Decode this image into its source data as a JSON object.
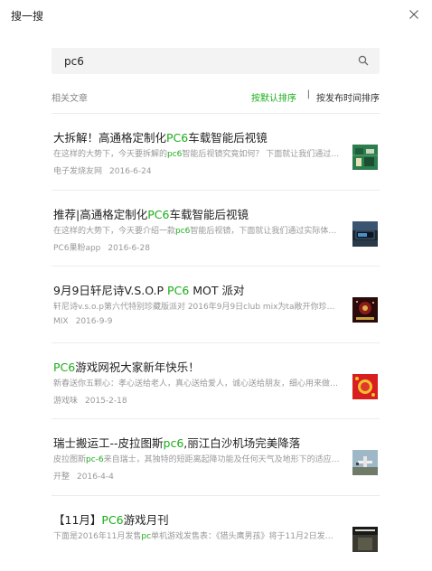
{
  "app": {
    "title": "搜一搜"
  },
  "search": {
    "value": "pc6",
    "placeholder": ""
  },
  "filter": {
    "label": "相关文章",
    "sort_default": "按默认排序",
    "separator": "|",
    "sort_time": "按发布时间排序",
    "active": "sort_default"
  },
  "accent_color": "#1aad19",
  "results": [
    {
      "title_pre": "大拆解！高通格定制化",
      "title_hl": "PC6",
      "title_post": "车载智能后视镜",
      "snippet_pre": "在这样的大势下，今天要拆解的",
      "snippet_hl": "pc6",
      "snippet_post": "智能后视镜究竟如何？ 下面就让我们通过拆解…",
      "source": "电子发烧友网",
      "date": "2016-6-24",
      "thumb": "circuit-board-image"
    },
    {
      "title_pre": "推荐|高通格定制化",
      "title_hl": "PC6",
      "title_post": "车载智能后视镜",
      "snippet_pre": "在这样的大势下，今天要介绍一款",
      "snippet_hl": "pc6",
      "snippet_post": "智能后视镜，下面就让我们通过实际体验…",
      "source": "PC6果粉app",
      "date": "2016-6-28",
      "thumb": "car-dashboard-image"
    },
    {
      "title_pre": "9月9日轩尼诗V.S.O.P ",
      "title_hl": "PC6",
      "title_post": " MOT 派对",
      "snippet_pre": "轩尼诗v.s.o.p第六代特别珍藏版派对 2016年9月9日club mix为ta敞开你珍藏的…",
      "snippet_hl": "",
      "snippet_post": "",
      "source": "MIX",
      "date": "2016-9-9",
      "thumb": "party-poster-image"
    },
    {
      "title_pre": "",
      "title_hl": "PC6",
      "title_post": "游戏网祝大家新年快乐！",
      "snippet_pre": "新春送你五颗心：孝心送给老人，真心送给爱人，诚心送给朋友，细心用来做事…",
      "snippet_hl": "",
      "snippet_post": "",
      "source": "游戏味",
      "date": "2015-2-18",
      "thumb": "new-year-red-image"
    },
    {
      "title_pre": "瑞士搬运工--皮拉图斯",
      "title_hl": "pc6",
      "title_post": ",丽江白沙机场完美降落",
      "snippet_pre": "皮拉图斯",
      "snippet_hl": "pc-6",
      "snippet_post": "来自瑞士，其独特的短距离起降功能及任何天气及地形下的适应…",
      "source": "开整",
      "date": "2016-4-4",
      "thumb": "airplane-image"
    },
    {
      "title_pre": "【11月】",
      "title_hl": "PC6",
      "title_post": "游戏月刊",
      "snippet_pre": "下面是2016年11月发售",
      "snippet_hl": "pc",
      "snippet_post": "单机游戏发售表：《猎头鹰男孩》将于11月2日发布…",
      "source": "",
      "date": "",
      "thumb": "call-of-duty-cover-image"
    }
  ]
}
